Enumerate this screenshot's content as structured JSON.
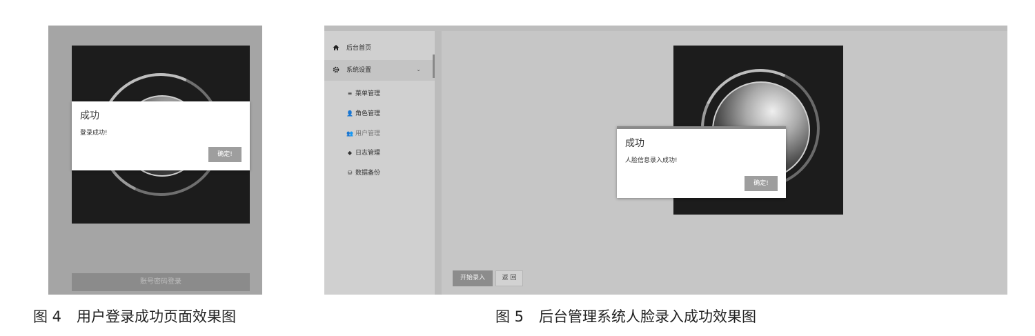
{
  "figure4": {
    "dialog": {
      "title": "成功",
      "message": "登录成功!",
      "confirm_label": "确定!"
    },
    "login_button_label": "账号密码登录",
    "caption_number": "图 4",
    "caption_text": "用户登录成功页面效果图"
  },
  "figure5": {
    "sidebar": {
      "home_label": "后台首页",
      "settings_label": "系统设置",
      "sub_items": [
        {
          "label": "菜单管理",
          "icon": "list-icon"
        },
        {
          "label": "角色管理",
          "icon": "role-icon"
        },
        {
          "label": "用户管理",
          "icon": "users-icon"
        },
        {
          "label": "日志管理",
          "icon": "tag-icon"
        },
        {
          "label": "数据备份",
          "icon": "database-icon"
        }
      ]
    },
    "dialog": {
      "title": "成功",
      "message": "人脸信息录入成功!",
      "confirm_label": "确定!"
    },
    "start_button_label": "开始录入",
    "back_button_label": "返 回",
    "caption_number": "图 5",
    "caption_text": "后台管理系统人脸录入成功效果图"
  },
  "colors": {
    "dialog_bg": "#ffffff",
    "overlay": "#a5a5a5",
    "button": "#9e9e9e"
  }
}
